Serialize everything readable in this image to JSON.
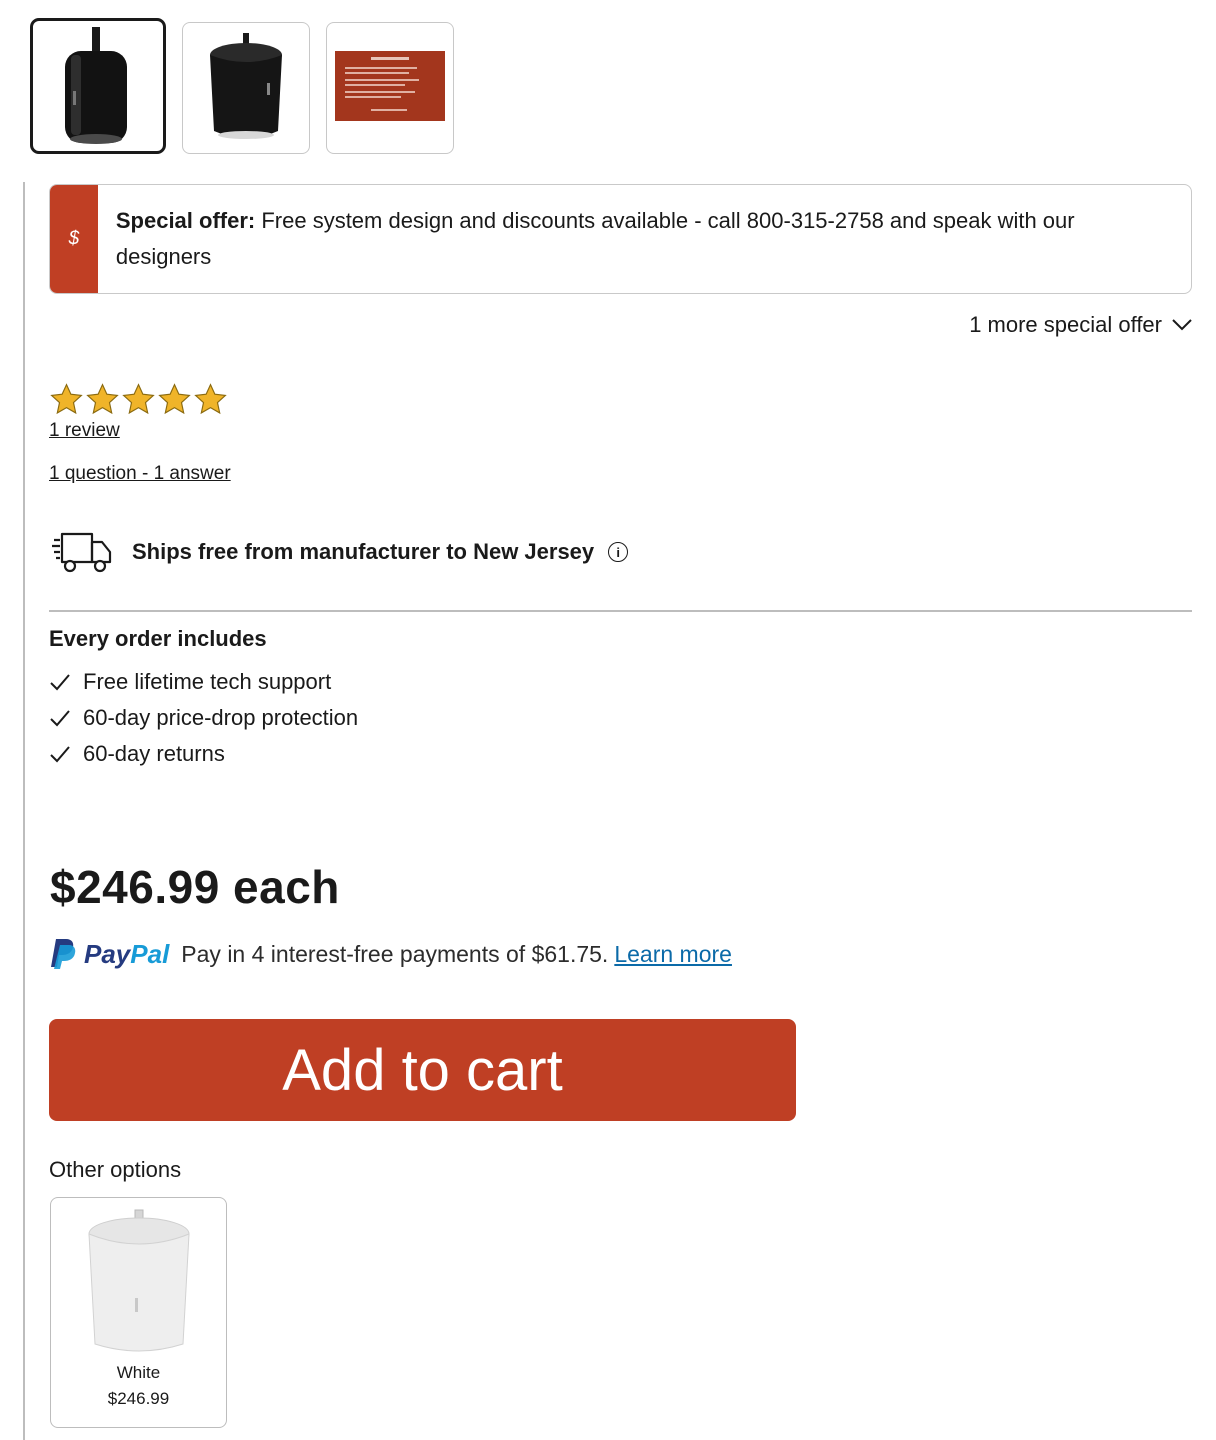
{
  "offer": {
    "badge_symbol": "$",
    "lead": "Special offer:",
    "text": " Free system design and discounts available - call 800-315-2758 and speak with our designers",
    "more": "1 more special offer"
  },
  "rating": {
    "stars": 5,
    "reviews_link": "1 review",
    "qa_link": "1 question - 1 answer"
  },
  "shipping": {
    "text": "Ships free from manufacturer to New Jersey",
    "info_symbol": "i"
  },
  "includes": {
    "title": "Every order includes",
    "items": [
      "Free lifetime tech support",
      "60-day price-drop protection",
      "60-day returns"
    ]
  },
  "price": "$246.99 each",
  "paypal": {
    "brand_a": "Pay",
    "brand_b": "Pal",
    "text": "Pay in 4 interest-free payments of $61.75.",
    "link": "Learn more"
  },
  "cart_button": "Add to cart",
  "other_options": {
    "title": "Other options",
    "items": [
      {
        "name": "White",
        "price": "$246.99"
      }
    ]
  },
  "colors": {
    "accent": "#bf3f24",
    "paypal_dark": "#253b80",
    "paypal_light": "#179bd7",
    "link": "#0b6aa8",
    "star": "#f0b429"
  }
}
